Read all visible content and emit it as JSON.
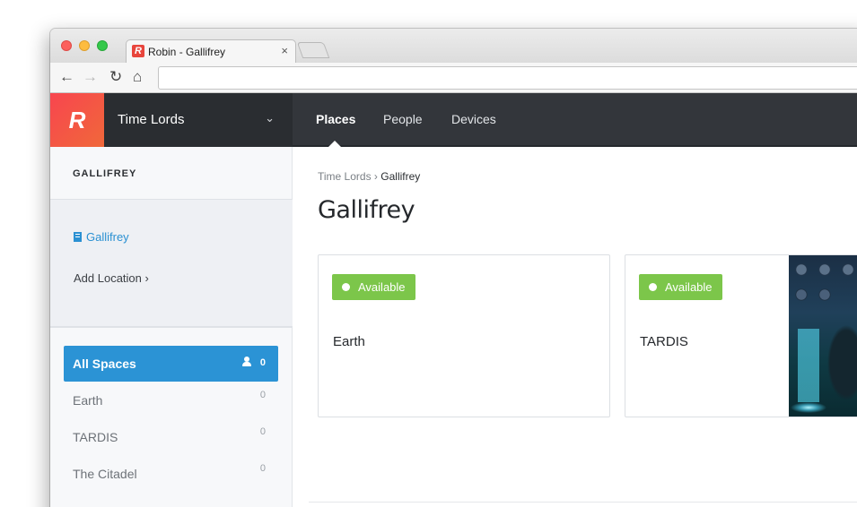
{
  "browser": {
    "tab_title": "Robin - Gallifrey",
    "tab_favicon_letter": "R",
    "tab_close": "×",
    "url": ""
  },
  "app": {
    "logo_letter": "R",
    "organization": "Time Lords",
    "nav": [
      {
        "label": "Places",
        "active": true
      },
      {
        "label": "People",
        "active": false
      },
      {
        "label": "Devices",
        "active": false
      }
    ]
  },
  "sidebar": {
    "heading": "GALLIFREY",
    "location": "Gallifrey",
    "add_location": "Add Location ›",
    "spaces": [
      {
        "label": "All Spaces",
        "count": "0",
        "active": true
      },
      {
        "label": "Earth",
        "count": "0",
        "active": false
      },
      {
        "label": "TARDIS",
        "count": "0",
        "active": false
      },
      {
        "label": "The Citadel",
        "count": "0",
        "active": false
      }
    ]
  },
  "main": {
    "breadcrumb": {
      "parent": "Time Lords",
      "separator": "›",
      "current": "Gallifrey"
    },
    "title": "Gallifrey",
    "cards": [
      {
        "status": "Available",
        "name": "Earth",
        "has_photo": false
      },
      {
        "status": "Available",
        "name": "TARDIS",
        "has_photo": true
      }
    ]
  },
  "colors": {
    "brand": "#f8454f",
    "accent": "#2b93d5",
    "available": "#7cc64a",
    "nav_dark": "#33363b"
  }
}
